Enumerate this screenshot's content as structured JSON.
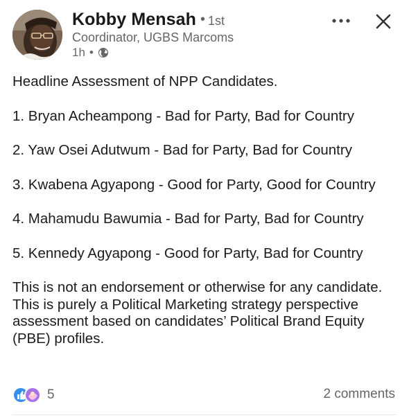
{
  "author": {
    "name": "Kobby Mensah",
    "connection_degree": "1st",
    "headline": "Coordinator, UGBS Marcoms",
    "time_ago": "1h",
    "visibility_icon": "globe-icon"
  },
  "actions": {
    "more_icon": "more-horizontal-icon",
    "close_icon": "close-icon"
  },
  "post": {
    "title": "Headline Assessment of NPP Candidates.",
    "items": [
      "1. Bryan Acheampong - Bad for Party, Bad for Country",
      "2. Yaw Osei Adutwum - Bad for Party, Bad for Country",
      "3. Kwabena Agyapong - Good for Party, Good for Country",
      "4. Mahamudu Bawumia - Bad for Party, Bad for Country",
      "5. Kennedy Agyapong - Good for Party, Bad for Country"
    ],
    "disclaimer": "This is not an endorsement or otherwise for any candidate. This is purely a Political Marketing strategy perspective assessment based on candidates’ Political Brand Equity (PBE) profiles."
  },
  "footer": {
    "reaction_icons": [
      "like-icon",
      "support-icon"
    ],
    "reaction_count": "5",
    "comments": "2 comments"
  },
  "colors": {
    "text_primary": "#1b1b1b",
    "text_secondary": "#666666",
    "like_blue": "#378fe9",
    "support_purple": "#a872e8",
    "divider": "#e6e6e6"
  }
}
